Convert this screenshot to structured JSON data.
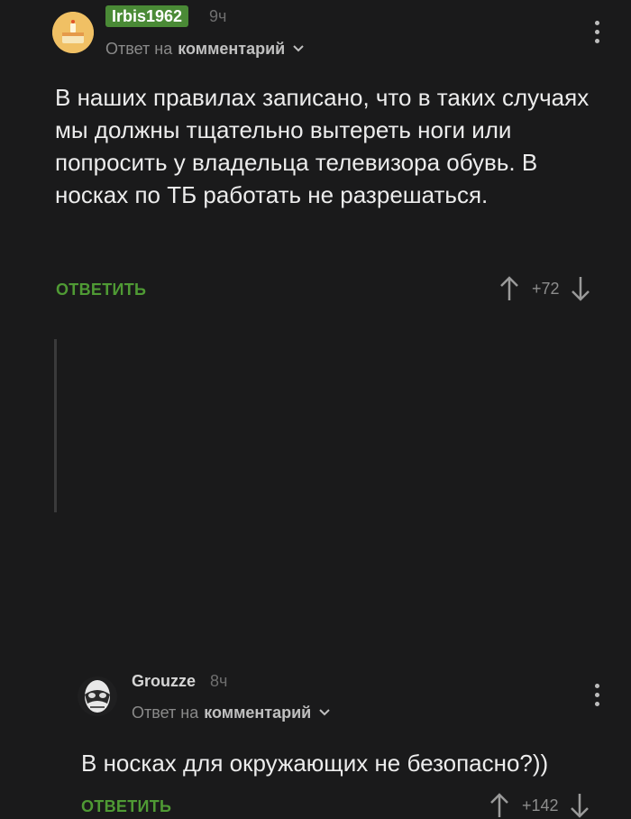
{
  "comments": [
    {
      "author": "Irbis1962",
      "time": "9ч",
      "reply_prefix": "Ответ на",
      "reply_target": "комментарий",
      "body": "В наших правилах записано, что в таких случаях мы должны тщательно вытереть ноги или попросить у владельца телевизора обувь. В носках по ТБ работать не разрешаться.",
      "reply_label": "ОТВЕТИТЬ",
      "score": "+72"
    },
    {
      "author": "Grouzze",
      "time": "8ч",
      "reply_prefix": "Ответ на",
      "reply_target": "комментарий",
      "body": "В носках для окружающих не безопасно?))",
      "reply_label": "ОТВЕТИТЬ",
      "score": "+142"
    }
  ],
  "colors": {
    "background": "#1a1a1b",
    "accent_green": "#4f9a34",
    "author_badge_bg": "#4a8a36"
  },
  "icons": [
    "avatar-cake",
    "avatar-mask",
    "chevron-down-icon",
    "kebab-icon",
    "arrow-up-icon",
    "arrow-down-icon"
  ]
}
